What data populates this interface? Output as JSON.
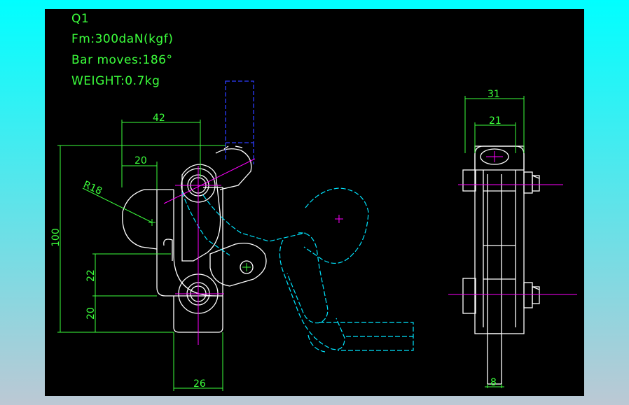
{
  "notes": {
    "model": "Q1",
    "force": "Fm:300daN(kgf)",
    "bar_moves": "Bar moves:186°",
    "weight": "WEIGHT:0.7kg"
  },
  "dims": {
    "d42": "42",
    "d20_top": "20",
    "r18": "R18",
    "d100": "100",
    "d22": "22",
    "d20_left": "20",
    "d26": "26",
    "d31": "31",
    "d21": "21",
    "d8": "8"
  },
  "colors": {
    "background_top": "#00ffff",
    "background_bottom": "#bcc8d4",
    "drawing": "#ffffff",
    "dimension": "#3cff3c",
    "centerline": "#ff00ff",
    "phantom": "#00e5ff",
    "handle": "#2c3cff"
  }
}
